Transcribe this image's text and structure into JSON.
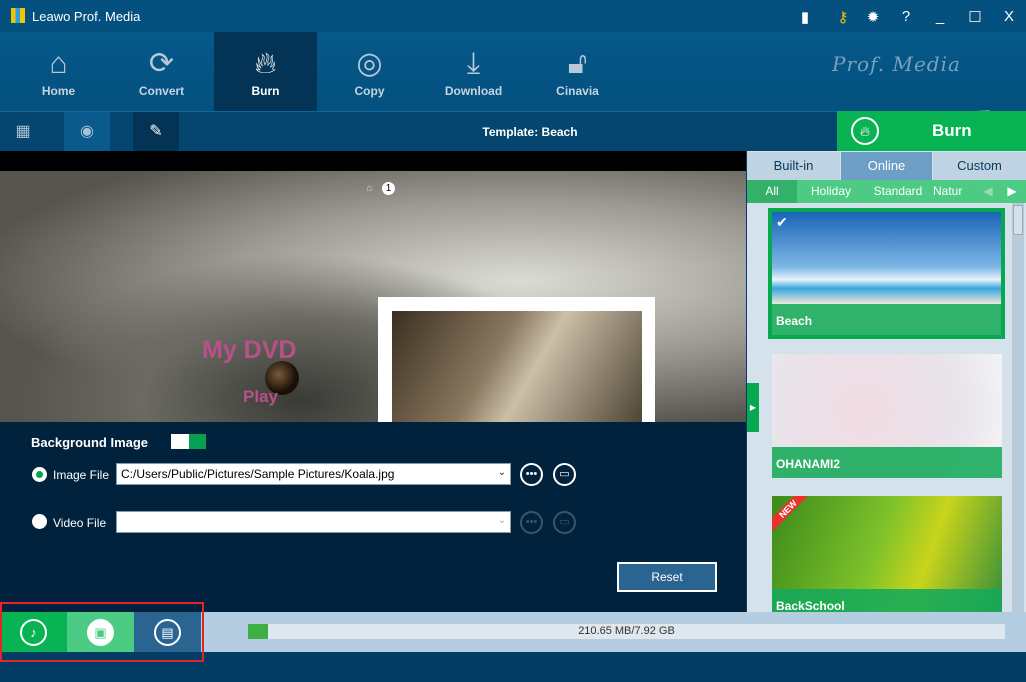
{
  "app": {
    "title": "Leawo Prof. Media",
    "brand": "Prof. Media"
  },
  "window_controls": {
    "feedback": "feedback-icon",
    "register": "key-icon",
    "settings": "gear-icon",
    "help": "help-icon",
    "minimize": "_",
    "maximize": "☐",
    "close": "X"
  },
  "nav": [
    {
      "label": "Home",
      "icon": "home-icon"
    },
    {
      "label": "Convert",
      "icon": "convert-icon"
    },
    {
      "label": "Burn",
      "icon": "burn-icon",
      "active": true
    },
    {
      "label": "Copy",
      "icon": "copy-icon"
    },
    {
      "label": "Download",
      "icon": "download-icon"
    },
    {
      "label": "Cinavia",
      "icon": "cinavia-icon"
    }
  ],
  "subbar": {
    "template_label": "Template: Beach",
    "burn_label": "Burn"
  },
  "preview": {
    "title": "My DVD",
    "play": "Play",
    "page": "1"
  },
  "panel": {
    "bg_label": "Background Image",
    "image_file_label": "Image File",
    "image_file_value": "C:/Users/Public/Pictures/Sample Pictures/Koala.jpg",
    "video_file_label": "Video File",
    "video_file_value": "",
    "reset": "Reset"
  },
  "right": {
    "tabs": [
      "Built-in",
      "Online",
      "Custom"
    ],
    "active_tab": "Online",
    "subtabs": [
      "All",
      "Holiday",
      "Standard",
      "Natur"
    ],
    "templates": [
      {
        "name": "Beach",
        "selected": true
      },
      {
        "name": "OHANAMI2"
      },
      {
        "name": "BackSchool",
        "badge": "NEW"
      }
    ]
  },
  "status": {
    "size": "210.65 MB/7.92 GB",
    "progress_percent": 2.6
  },
  "colors": {
    "accent": "#07b352",
    "header": "#04507e",
    "panel": "#00223c"
  }
}
